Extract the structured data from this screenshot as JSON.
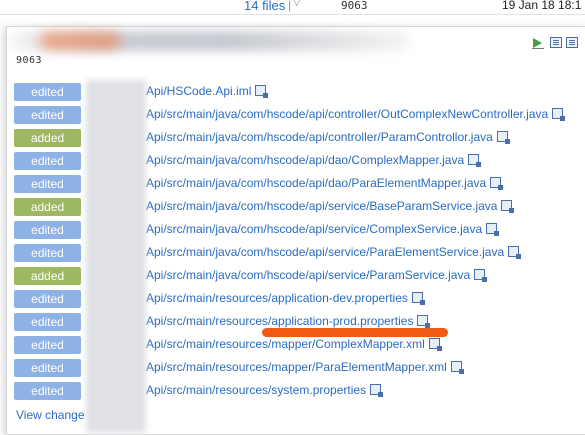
{
  "top": {
    "files_link": "14 files",
    "separator": "|",
    "caret": "▽",
    "hash": "9063",
    "date": "19 Jan 18 18:1"
  },
  "popup": {
    "hash": "9063",
    "icons": [
      "run-icon",
      "open-in-ide-icon",
      "copy-icon"
    ],
    "view_changes": "View change",
    "files": [
      {
        "status": "edited",
        "path": "Api/HSCode.Api.iml"
      },
      {
        "status": "edited",
        "path": "Api/src/main/java/com/hscode/api/controller/OutComplexNewController.java"
      },
      {
        "status": "added",
        "path": "Api/src/main/java/com/hscode/api/controller/ParamControllor.java"
      },
      {
        "status": "edited",
        "path": "Api/src/main/java/com/hscode/api/dao/ComplexMapper.java"
      },
      {
        "status": "edited",
        "path": "Api/src/main/java/com/hscode/api/dao/ParaElementMapper.java"
      },
      {
        "status": "added",
        "path": "Api/src/main/java/com/hscode/api/service/BaseParamService.java"
      },
      {
        "status": "edited",
        "path": "Api/src/main/java/com/hscode/api/service/ComplexService.java"
      },
      {
        "status": "edited",
        "path": "Api/src/main/java/com/hscode/api/service/ParaElementService.java"
      },
      {
        "status": "added",
        "path": "Api/src/main/java/com/hscode/api/service/ParamService.java"
      },
      {
        "status": "edited",
        "path": "Api/src/main/resources/application-dev.properties"
      },
      {
        "status": "edited",
        "path": "Api/src/main/resources/application-prod.properties"
      },
      {
        "status": "edited",
        "path": "Api/src/main/resources/mapper/ComplexMapper.xml"
      },
      {
        "status": "edited",
        "path": "Api/src/main/resources/mapper/ParaElementMapper.xml"
      },
      {
        "status": "edited",
        "path": "Api/src/main/resources/system.properties"
      }
    ]
  },
  "colors": {
    "edited": "#8fb2e6",
    "added": "#9db861",
    "link": "#2a6cc0",
    "highlight": "#f05a12"
  }
}
